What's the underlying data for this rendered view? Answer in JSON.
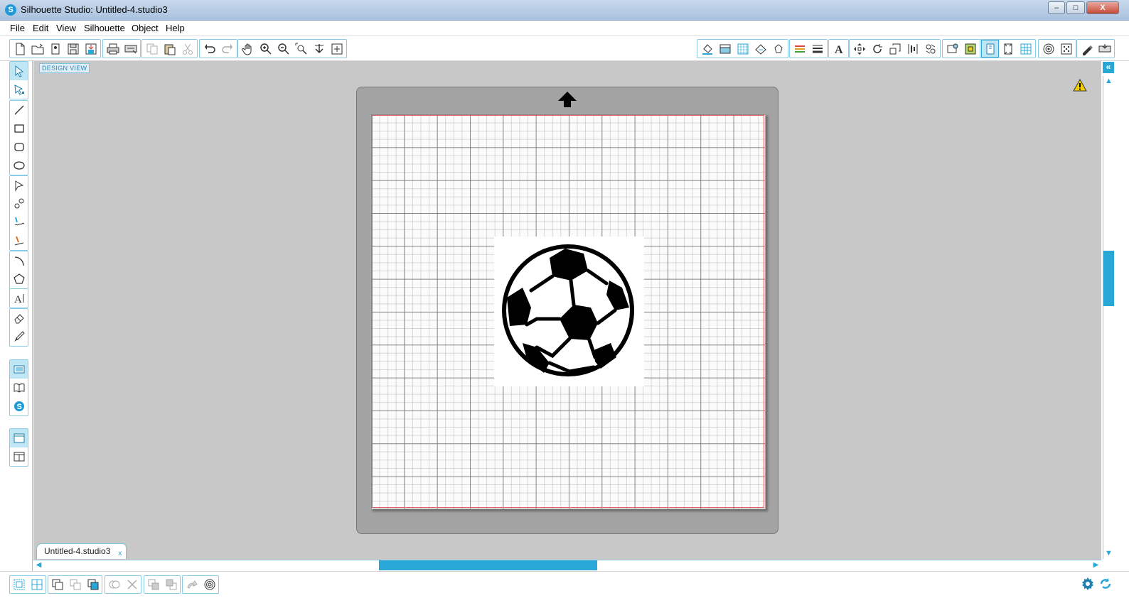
{
  "window": {
    "title": "Silhouette Studio: Untitled-4.studio3",
    "logo_letter": "S",
    "minimize_label": "–",
    "maximize_label": "□",
    "close_label": "X"
  },
  "menu": {
    "items": [
      "File",
      "Edit",
      "View",
      "Silhouette",
      "Object",
      "Help"
    ]
  },
  "toolbar": {
    "left_groups": [
      [
        "new-document-icon",
        "open-folder-icon",
        "library-icon",
        "save-icon",
        "save-to-library-icon"
      ],
      [
        "print-icon",
        "print-cut-icon"
      ],
      [
        "copy-icon",
        "paste-icon",
        "cut-scissors-icon"
      ],
      [
        "undo-icon",
        "redo-icon"
      ],
      [
        "pan-hand-icon",
        "zoom-in-icon",
        "zoom-out-icon",
        "zoom-select-icon",
        "drag-zoom-icon",
        "fit-to-page-icon"
      ]
    ],
    "right_groups": [
      [
        "fill-color-icon",
        "gradient-icon",
        "fill-pattern-icon",
        "sketch-icon",
        "offset-shape-icon"
      ],
      [
        "line-color-icon",
        "line-style-icon"
      ],
      [
        "text-style-icon"
      ],
      [
        "transform-icon",
        "rotate-icon",
        "scale-icon",
        "align-icon",
        "replicate-icon"
      ],
      [
        "modify-icon",
        "offset-icon",
        "trace-icon"
      ],
      [
        "page-setup-icon",
        "registration-marks-icon",
        "grid-settings-icon"
      ],
      [
        "trace-area-icon",
        "pixscan-icon"
      ],
      [
        "cut-settings-icon",
        "send-to-silhouette-icon"
      ]
    ]
  },
  "left_tools": {
    "groups": [
      [
        "select-arrow-icon",
        "edit-points-icon"
      ],
      [
        "line-tool-icon",
        "rectangle-tool-icon",
        "rounded-rectangle-tool-icon",
        "ellipse-tool-icon"
      ],
      [
        "polygon-tool-icon",
        "curve-tool-icon",
        "freehand-tool-icon",
        "smooth-freehand-tool-icon"
      ],
      [
        "arc-tool-icon",
        "regular-polygon-tool-icon"
      ],
      [
        "text-tool-icon"
      ],
      [
        "eraser-tool-icon",
        "knife-tool-icon"
      ],
      [
        "design-page-icon",
        "library-view-icon",
        "silhouette-store-icon"
      ],
      [
        "single-panel-icon",
        "split-panel-icon"
      ]
    ]
  },
  "canvas": {
    "view_label": "DESIGN VIEW"
  },
  "document_tab": {
    "label": "Untitled-4.studio3",
    "close_glyph": "x"
  },
  "bottom_toolbar": {
    "groups": [
      [
        "group-icon",
        "ungroup-icon"
      ],
      [
        "make-compound-icon",
        "release-compound-icon",
        "bring-forward-icon"
      ],
      [
        "weld-icon",
        "delete-icon"
      ],
      [
        "bring-to-front-icon",
        "send-to-back-icon"
      ],
      [
        "rotate-view-icon",
        "offset-view-icon"
      ]
    ]
  },
  "colors": {
    "accent": "#29a8d8",
    "mat": "#a3a3a3",
    "cut_border": "#e46060",
    "canvas_bg": "#c8c8c8"
  }
}
